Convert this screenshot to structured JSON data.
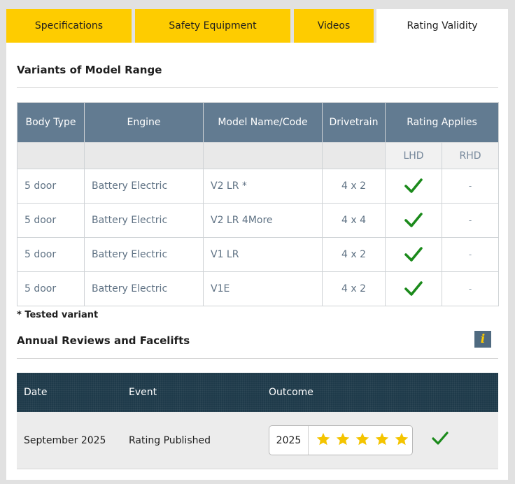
{
  "tabs": [
    {
      "label": "Specifications"
    },
    {
      "label": "Safety Equipment"
    },
    {
      "label": "Videos"
    },
    {
      "label": "Rating Validity"
    }
  ],
  "active_tab": "Rating Validity",
  "colors": {
    "tab_yellow": "#fecc00",
    "header_blue": "#627b91",
    "review_header": "#1e3a4a",
    "check_green": "#1b8a1b",
    "star_gold": "#f4c400"
  },
  "variants": {
    "title": "Variants of Model Range",
    "columns": [
      "Body Type",
      "Engine",
      "Model Name/Code",
      "Drivetrain",
      "Rating Applies"
    ],
    "sub_columns": [
      "LHD",
      "RHD"
    ],
    "rows": [
      {
        "body": "5 door",
        "engine": "Battery Electric",
        "model": "V2 LR *",
        "drivetrain": "4 x 2",
        "lhd": "check-icon",
        "rhd": "-"
      },
      {
        "body": "5 door",
        "engine": "Battery Electric",
        "model": "V2 LR 4More",
        "drivetrain": "4 x 4",
        "lhd": "check-icon",
        "rhd": "-"
      },
      {
        "body": "5 door",
        "engine": "Battery Electric",
        "model": "V1 LR",
        "drivetrain": "4 x 2",
        "lhd": "check-icon",
        "rhd": "-"
      },
      {
        "body": "5 door",
        "engine": "Battery Electric",
        "model": "V1E",
        "drivetrain": "4 x 2",
        "lhd": "check-icon",
        "rhd": "-"
      }
    ],
    "note": "* Tested variant"
  },
  "reviews": {
    "title": "Annual Reviews and Facelifts",
    "info_icon": "i",
    "columns": [
      "Date",
      "Event",
      "Outcome"
    ],
    "rows": [
      {
        "date": "September 2025",
        "event": "Rating Published",
        "year": "2025",
        "stars": 5,
        "status": "check-icon"
      }
    ]
  }
}
